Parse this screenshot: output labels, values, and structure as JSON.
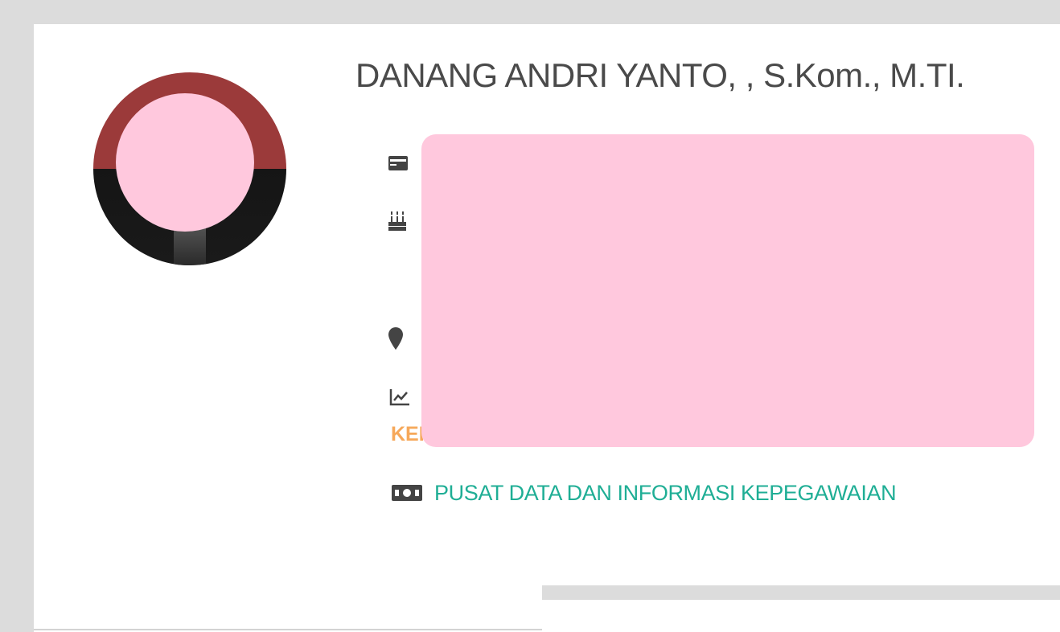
{
  "profile": {
    "name": "DANANG ANDRI YANTO, , S.Kom., M.TI.",
    "status_peek": "KEI",
    "unit": "PUSAT DATA DAN INFORMASI KEPEGAWAIAN"
  },
  "icons": {
    "id_card": "id-card-icon",
    "birthday": "birthday-cake-icon",
    "location": "map-marker-icon",
    "rank": "chart-line-icon",
    "unit": "money-bill-icon"
  },
  "colors": {
    "status_text": "#f6a85a",
    "unit_text": "#1fae95",
    "redaction": "#ffc8dd",
    "frame_background": "#dcdcdc"
  }
}
